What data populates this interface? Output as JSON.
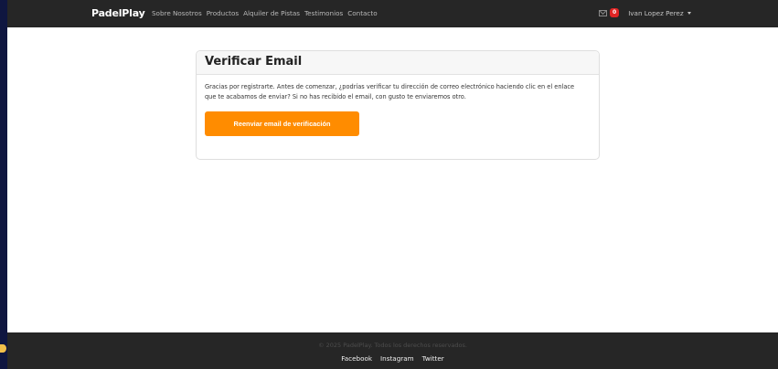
{
  "nav": {
    "brand": "PadelPlay",
    "links": [
      "Sobre Nosotros",
      "Productos",
      "Alquiler de Pistas",
      "Testimonios",
      "Contacto"
    ],
    "notification_count": "0",
    "user_name": "Ivan Lopez Perez",
    "icons": {
      "mail": "mail-icon",
      "caret": "chevron-down-icon"
    }
  },
  "card": {
    "title": "Verificar Email",
    "text": "Gracias por registrarte. Antes de comenzar, ¿podrías verificar tu dirección de correo electrónico haciendo clic en el enlace que te acabamos de enviar? Si no has recibido el email, con gusto te enviaremos otro.",
    "button_label": "Reenviar email de verificación"
  },
  "footer": {
    "copyright": "© 2025 PadelPlay. Todos los derechos reservados.",
    "links": [
      "Facebook",
      "Instagram",
      "Twitter"
    ]
  },
  "colors": {
    "accent": "#ff8c00",
    "navbar": "#262626",
    "badge": "#e02424",
    "outer_background": "#0f1640"
  }
}
